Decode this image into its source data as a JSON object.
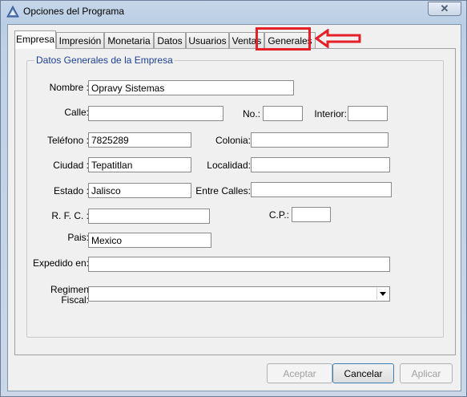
{
  "window": {
    "title": "Opciones del Programa",
    "close_label": "✕"
  },
  "tabs": [
    {
      "label": "Empresa",
      "active": true
    },
    {
      "label": "Impresión"
    },
    {
      "label": "Monetaria"
    },
    {
      "label": "Datos"
    },
    {
      "label": "Usuarios"
    },
    {
      "label": "Ventas"
    },
    {
      "label": "Generales",
      "highlighted": true
    }
  ],
  "group": {
    "legend": "Datos Generales de la Empresa"
  },
  "fields": {
    "nombre": {
      "label": "Nombre :",
      "value": "Opravy Sistemas"
    },
    "calle": {
      "label": "Calle:",
      "value": ""
    },
    "no": {
      "label": "No.:",
      "value": ""
    },
    "interior": {
      "label": "Interior:",
      "value": ""
    },
    "telefono": {
      "label": "Teléfono :",
      "value": "7825289"
    },
    "colonia": {
      "label": "Colonia:",
      "value": ""
    },
    "ciudad": {
      "label": "Ciudad :",
      "value": "Tepatitlan"
    },
    "localidad": {
      "label": "Localidad:",
      "value": ""
    },
    "estado": {
      "label": "Estado :",
      "value": "Jalisco"
    },
    "entre_calles": {
      "label": "Entre Calles:",
      "value": ""
    },
    "rfc": {
      "label": "R. F. C. :",
      "value": ""
    },
    "cp": {
      "label": "C.P.:",
      "value": ""
    },
    "pais": {
      "label": "Pais:",
      "value": "Mexico"
    },
    "expedido_en": {
      "label": "Expedido en:",
      "value": ""
    },
    "regimen_fiscal": {
      "label_line1": "Regimen",
      "label_line2": "Fiscal:",
      "value": ""
    }
  },
  "buttons": {
    "aceptar": {
      "label": "Aceptar",
      "enabled": false
    },
    "cancelar": {
      "label": "Cancelar",
      "enabled": true
    },
    "aplicar": {
      "label": "Aplicar",
      "enabled": false
    }
  },
  "annotation": {
    "color": "#e41f26",
    "icon": "left-arrow-icon"
  }
}
